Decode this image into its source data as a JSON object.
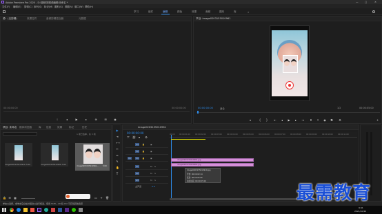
{
  "titlebar": {
    "title": "Adobe Premiere Pro 2020 - D:\\视频\\短视频编辑\\未命名 *",
    "min_label": "—",
    "max_label": "□",
    "close_label": "✕"
  },
  "menu": {
    "items": [
      "文件(F)",
      "编辑(E)",
      "剪辑(C)",
      "序列(S)",
      "标记(M)",
      "图形(G)",
      "视图(V)",
      "窗口(W)",
      "帮助(H)"
    ]
  },
  "workspaces": {
    "items": [
      "学习",
      "组件",
      "编辑",
      "颜色",
      "效果",
      "音频",
      "图形",
      "库"
    ],
    "active_index": 2,
    "more_label": "»"
  },
  "source_panel": {
    "tabs": [
      "源：(无剪辑)",
      "效果控件",
      "音频剪辑混合器",
      "元数据"
    ],
    "timecode_left": "00:00:00:00",
    "timecode_right": "00:00:00:00"
  },
  "program_panel": {
    "tab": "节目: image0203155010961",
    "timecode_left": "00:00:00:00",
    "fit_label": "适合",
    "quality_label": "1/2",
    "timecode_right": "00:00:05:00"
  },
  "project_panel": {
    "tabs": [
      "项目: 未命名",
      "媒体浏览器",
      "库",
      "信息",
      "效果",
      "标记",
      "历史"
    ],
    "item_count_label": "1 项已选择，共 3 项",
    "items": [
      {
        "name": "image0203155010910.jpg",
        "duration": "5:00"
      },
      {
        "name": "image0203155010930.jpg",
        "duration": "5:00"
      },
      {
        "name": "image0203155010961...",
        "duration": "5:00"
      }
    ]
  },
  "timeline": {
    "tab": "image0203155010961",
    "timecode": "00:00:00:00",
    "ruler_ticks": [
      "00:00",
      "00:00:01:00",
      "00:00:02:00",
      "00:00:03:00",
      "00:00:04:00",
      "00:00:05:00",
      "00:00:06:00",
      "00:00:07:00",
      "00:00:08:00",
      "00:00:09:00",
      "00:00:10:00",
      "00:00:11:00"
    ],
    "tracks_video": [
      "V3",
      "V2",
      "V1"
    ],
    "tracks_audio": [
      "A1",
      "A2",
      "A3"
    ],
    "master_label": "主声道",
    "master_value": "0.0",
    "clip1_label": "image0203155010961.jpg",
    "clip2_label": "image0203155010961.jpg",
    "tooltip": {
      "name": "image0203155010910.jpg",
      "start": "开始: 00:00:02:14",
      "end": "结束: 00:00:05:06",
      "duration": "持续时间: 00:00:05:00"
    }
  },
  "statusbar": {
    "text": "单击以选择，或单击空白处并拖动以进行框选，使用 Shift、Alt 和 Ctrl 可获得其他选项"
  },
  "watermark": {
    "text": "最需教育"
  },
  "taskbar": {
    "time": "9:41",
    "date": "2021/10/22"
  },
  "colors": {
    "accent": "#2d8ceb",
    "clip": "#d68fd9",
    "watermark": "#1a4fd6"
  }
}
